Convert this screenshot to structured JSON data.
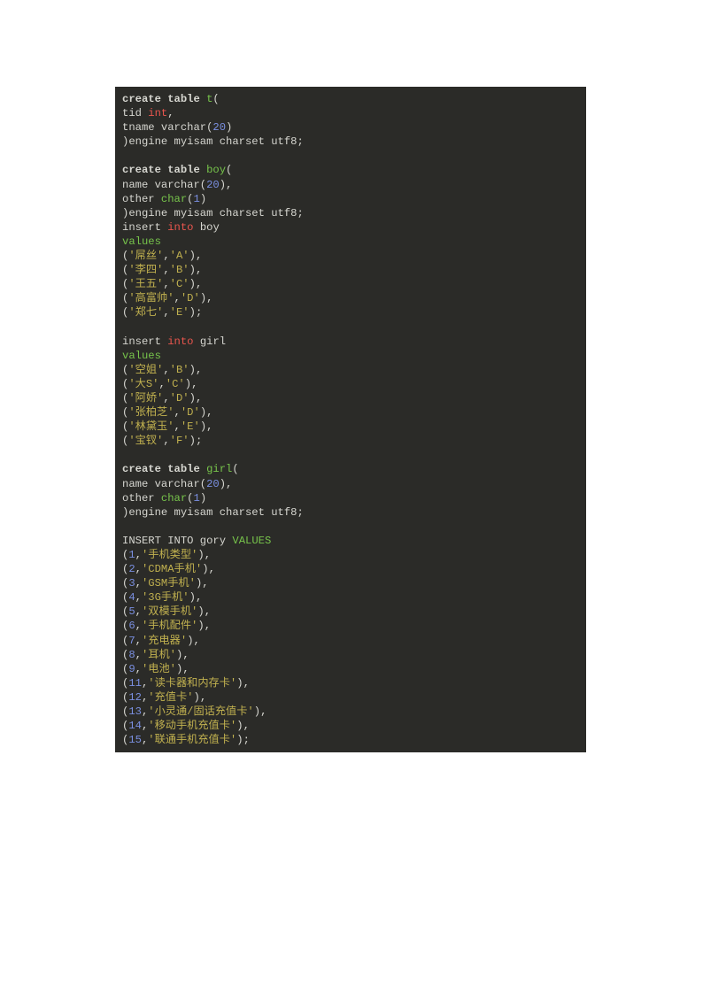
{
  "code": {
    "kw_create_table": "create table",
    "kw_engine": ")engine myisam charset utf8;",
    "kw_insert": "insert",
    "kw_into": "into",
    "kw_values": "values",
    "kw_INSERT_INTO": "INSERT INTO",
    "kw_VALUES": "VALUES",
    "field_tid": "tid",
    "type_int": "int",
    "field_tname": "tname varchar(",
    "n20": "20",
    "field_name": "name varchar(",
    "field_other": "other",
    "type_char": "char",
    "n1": "1",
    "tbl_t": "t",
    "tbl_boy": "boy",
    "tbl_girl": "girl",
    "tbl_gory": "gory",
    "boy_rows": [
      {
        "a": "'屌丝'",
        "b": "'A'",
        "sep": "),"
      },
      {
        "a": "'李四'",
        "b": "'B'",
        "sep": "),"
      },
      {
        "a": "'王五'",
        "b": "'C'",
        "sep": "),"
      },
      {
        "a": "'高富帅'",
        "b": "'D'",
        "sep": "),"
      },
      {
        "a": "'郑七'",
        "b": "'E'",
        "sep": ");"
      }
    ],
    "girl_rows": [
      {
        "a": "'空姐'",
        "b": "'B'",
        "sep": "),"
      },
      {
        "a": "'大S'",
        "b": "'C'",
        "sep": "),"
      },
      {
        "a": "'阿娇'",
        "b": "'D'",
        "sep": "),"
      },
      {
        "a": "'张柏芝'",
        "b": "'D'",
        "sep": "),"
      },
      {
        "a": "'林黛玉'",
        "b": "'E'",
        "sep": "),"
      },
      {
        "a": "'宝钗'",
        "b": "'F'",
        "sep": ");"
      }
    ],
    "gory_rows": [
      {
        "n": "1",
        "s": "'手机类型'",
        "sep": "),"
      },
      {
        "n": "2",
        "s": "'CDMA手机'",
        "sep": "),"
      },
      {
        "n": "3",
        "s": "'GSM手机'",
        "sep": "),"
      },
      {
        "n": "4",
        "s": "'3G手机'",
        "sep": "),"
      },
      {
        "n": "5",
        "s": "'双模手机'",
        "sep": "),"
      },
      {
        "n": "6",
        "s": "'手机配件'",
        "sep": "),"
      },
      {
        "n": "7",
        "s": "'充电器'",
        "sep": "),"
      },
      {
        "n": "8",
        "s": "'耳机'",
        "sep": "),"
      },
      {
        "n": "9",
        "s": "'电池'",
        "sep": "),"
      },
      {
        "n": "11",
        "s": "'读卡器和内存卡'",
        "sep": "),"
      },
      {
        "n": "12",
        "s": "'充值卡'",
        "sep": "),"
      },
      {
        "n": "13",
        "s": "'小灵通/固话充值卡'",
        "sep": "),"
      },
      {
        "n": "14",
        "s": "'移动手机充值卡'",
        "sep": "),"
      },
      {
        "n": "15",
        "s": "'联通手机充值卡'",
        "sep": ");"
      }
    ]
  }
}
